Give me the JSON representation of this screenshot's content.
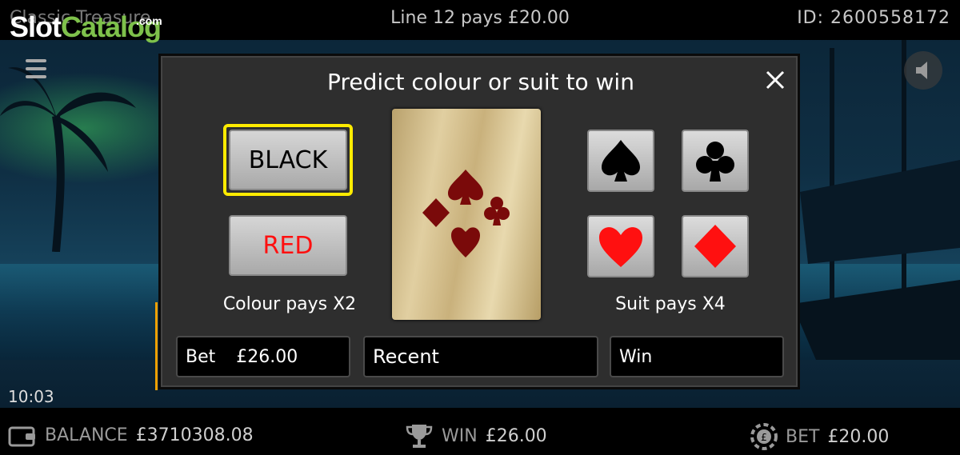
{
  "header": {
    "game_name": "Classic Treasure",
    "line_info": "Line 12 pays £20.00",
    "id_text": "ID: 2600558172"
  },
  "logo": {
    "slot": "Slot",
    "catalog": "Catalog",
    "com": ".com"
  },
  "clock": "10:03",
  "gamble": {
    "title": "Predict colour or suit to win",
    "black_label": "BLACK",
    "red_label": "RED",
    "colour_pays": "Colour pays X2",
    "suit_pays": "Suit pays X4",
    "selected_option": "BLACK",
    "suits": [
      "spade",
      "club",
      "heart",
      "diamond"
    ],
    "bet_label": "Bet",
    "bet_value": "£26.00",
    "recent_label": "Recent",
    "win_label": "Win"
  },
  "status": {
    "balance_label": "BALANCE",
    "balance_value": "£3710308.08",
    "win_label": "WIN",
    "win_value": "£26.00",
    "bet_label": "BET",
    "bet_value": "£20.00"
  },
  "colors": {
    "selected_outline": "#ffeb00",
    "red": "#ff1010",
    "black": "#000000",
    "logo_green": "#7ec14b"
  }
}
